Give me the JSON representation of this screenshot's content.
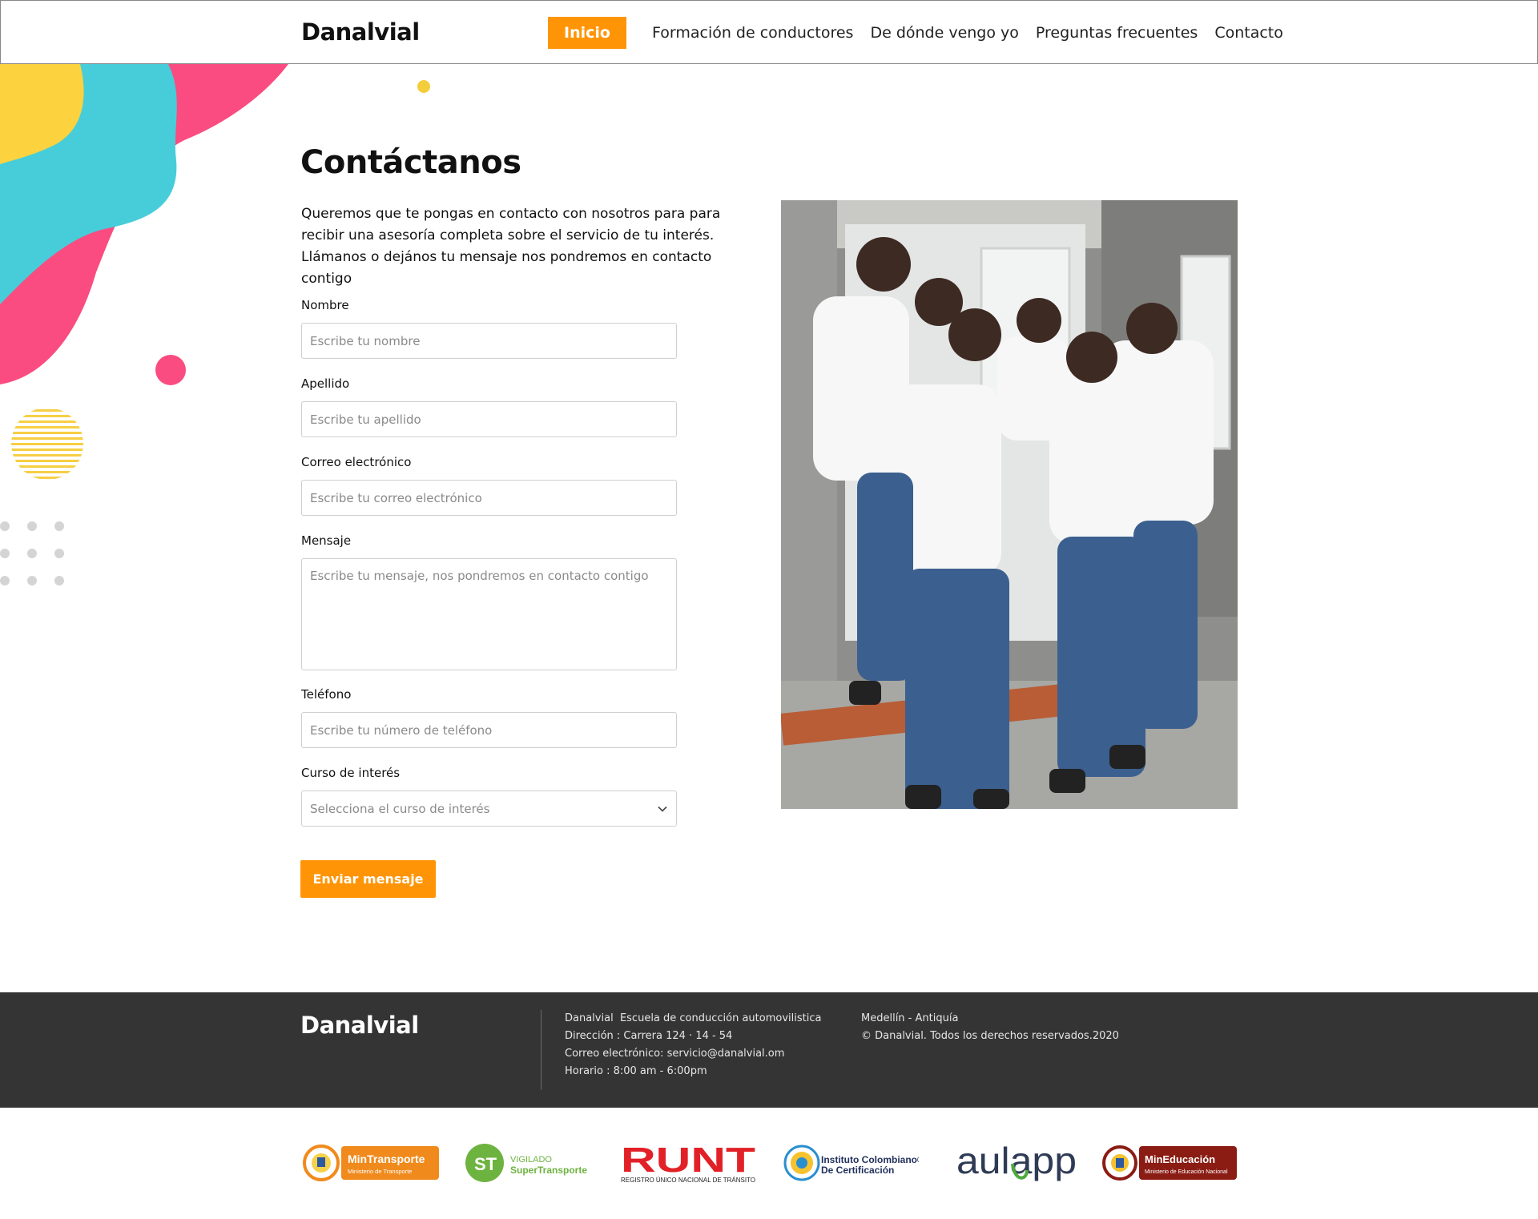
{
  "header": {
    "brand": "Danalvial",
    "nav": {
      "active": "Inicio",
      "items": [
        "Formación de conductores",
        "De dónde vengo yo",
        "Preguntas frecuentes",
        "Contacto"
      ]
    }
  },
  "main": {
    "title": "Contáctanos",
    "intro": "Queremos que te pongas en contacto con nosotros para para recibir una asesoría completa sobre el servicio de tu interés. Llámanos o dejános tu mensaje nos pondremos en contacto contigo",
    "form": {
      "nombre": {
        "label": "Nombre",
        "placeholder": "Escribe tu nombre"
      },
      "apellido": {
        "label": "Apellido",
        "placeholder": "Escribe tu apellido"
      },
      "correo": {
        "label": "Correo electrónico",
        "placeholder": "Escribe tu correo electrónico"
      },
      "mensaje": {
        "label": "Mensaje",
        "placeholder": "Escribe tu mensaje, nos pondremos en contacto contigo"
      },
      "telefono": {
        "label": "Teléfono",
        "placeholder": "Escribe tu número de teléfono"
      },
      "curso": {
        "label": "Curso de interés",
        "placeholder": "Selecciona el curso de interés"
      },
      "submit_label": "Enviar mensaje"
    }
  },
  "footer": {
    "brand": "Danalvial",
    "col1": [
      "Danalvial  Escuela de conducción automovilistica",
      "Dirección : Carrera 124 · 14 - 54",
      "Correo electrónico: servicio@danalvial.om",
      "Horario : 8:00 am - 6:00pm"
    ],
    "col2": [
      "Medellín - Antiquía",
      "© Danalvial. Todos los derechos reservados.2020"
    ]
  },
  "logos": {
    "mintransporte": {
      "title": "MinTransporte",
      "subtitle": "Ministerio de Transporte"
    },
    "supertransporte": {
      "mark": "ST",
      "line1": "VIGILADO",
      "line2": "SuperTransporte"
    },
    "runt": {
      "title": "RUNT",
      "subtitle": "REGISTRO ÚNICO NACIONAL DE TRÁNSITO"
    },
    "icontec": {
      "line1": "Instituto Colombiano®",
      "line2": "De Certificación"
    },
    "aulapp": {
      "text": "aulapp"
    },
    "mineducacion": {
      "title": "MinEducación",
      "subtitle": "Ministerio de Educación Nacional"
    }
  },
  "colors": {
    "accent": "#ff9506",
    "footer_bg": "#343434",
    "blob_yellow": "#fcd33e",
    "blob_teal": "#47cdd9",
    "blob_pink": "#fa4c80"
  },
  "icons": [
    "chevron-down-icon"
  ]
}
